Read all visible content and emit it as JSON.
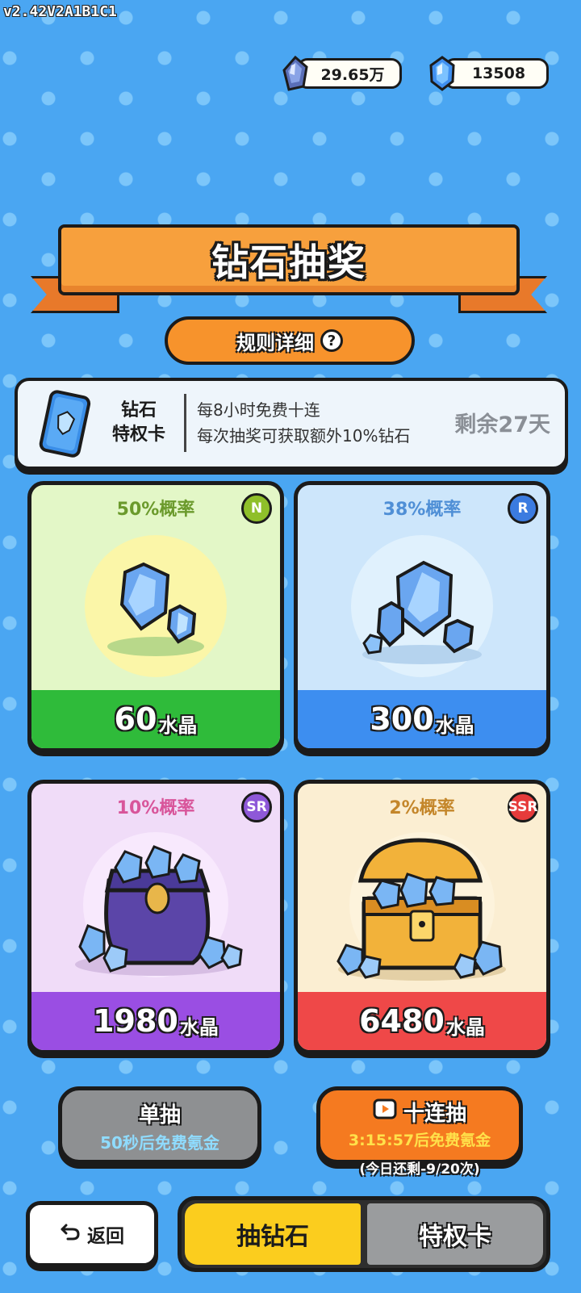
{
  "version": "v2.42V2A1B1C1",
  "currencies": [
    {
      "icon": "crystal-icon",
      "value": "29.65万"
    },
    {
      "icon": "diamond-icon",
      "value": "13508"
    }
  ],
  "banner": {
    "title": "钻石抽奖"
  },
  "rules_button": {
    "label": "规则详细",
    "icon": "question-icon"
  },
  "privilege_card": {
    "name_line1": "钻石",
    "name_line2": "特权卡",
    "desc_line1": "每8小时免费十连",
    "desc_line2": "每次抽奖可获取额外10%钻石",
    "remaining": "剩余27天"
  },
  "rewards": [
    {
      "probability": "50%概率",
      "rarity": "N",
      "amount": "60",
      "unit": "水晶",
      "color": "#2fbb3a"
    },
    {
      "probability": "38%概率",
      "rarity": "R",
      "amount": "300",
      "unit": "水晶",
      "color": "#3d8ef0"
    },
    {
      "probability": "10%概率",
      "rarity": "SR",
      "amount": "1980",
      "unit": "水晶",
      "color": "#9a4ee3"
    },
    {
      "probability": "2%概率",
      "rarity": "SSR",
      "amount": "6480",
      "unit": "水晶",
      "color": "#ef4848"
    }
  ],
  "draw": {
    "single_label": "单抽",
    "single_sub": "50秒后免费氪金",
    "ten_label": "十连抽",
    "ten_sub": "3:15:57后免费氪金",
    "remaining_today": "(今日还剩-9/20次)"
  },
  "bottom": {
    "back_label": "返回",
    "tabs": [
      "抽钻石",
      "特权卡"
    ],
    "active_tab": "抽钻石"
  }
}
